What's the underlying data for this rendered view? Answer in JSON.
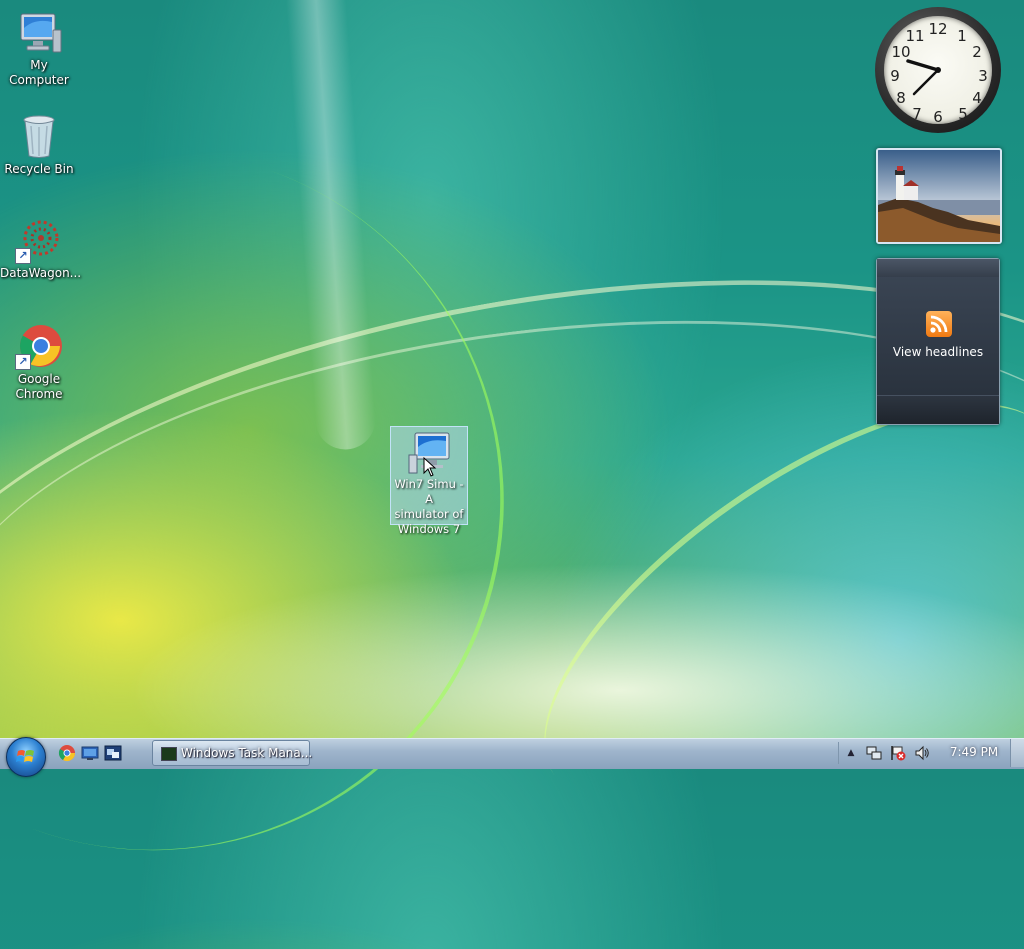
{
  "desktop": {
    "icons": [
      {
        "label": "My Computer"
      },
      {
        "label": "Recycle Bin"
      },
      {
        "label": "DataWagon..."
      },
      {
        "label": "Google Chrome"
      }
    ],
    "selected_icon": {
      "line1": "Win7 Simu - A",
      "line2": "simulator of",
      "line3": "Windows 7"
    }
  },
  "gadgets": {
    "clock": {
      "numbers": [
        "12",
        "1",
        "2",
        "3",
        "4",
        "5",
        "6",
        "7",
        "8",
        "9",
        "10",
        "11"
      ]
    },
    "feed": {
      "label": "View headlines"
    }
  },
  "taskbar": {
    "task_button_label": "Windows Task Mana...",
    "time": "7:49 PM",
    "overflow_arrow": "▲"
  },
  "colors": {
    "taskbar": "#9fb5cc",
    "selection": "#b4d7f0",
    "rss": "#f07a12"
  },
  "icons": {
    "start": "windows-orb-icon",
    "quicklaunch": [
      "chrome-icon",
      "show-desktop-icon",
      "switch-windows-icon"
    ],
    "tray": [
      "network-icon",
      "action-center-flag-icon",
      "volume-icon"
    ]
  }
}
